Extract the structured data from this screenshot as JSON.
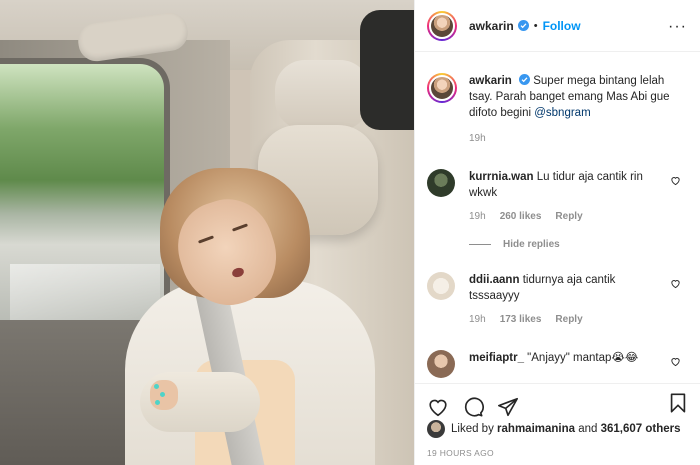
{
  "post": {
    "username": "awkarin",
    "follow_label": "Follow",
    "separator": "•",
    "more_label": "···"
  },
  "caption": {
    "username": "awkarin",
    "text": "Super mega bintang lelah tsay. Parah banget emang Mas Abi gue difoto begini",
    "mention": "@sbngram",
    "time": "19h"
  },
  "comments": [
    {
      "username": "kurrnia.wan",
      "text": "Lu tidur aja cantik rin wkwk",
      "time": "19h",
      "likes": "260 likes",
      "reply_label": "Reply",
      "hide_replies_label": "Hide replies"
    },
    {
      "username": "ddii.aann",
      "text": "tidurnya aja cantik tsssaayyy",
      "time": "19h",
      "likes": "173 likes",
      "reply_label": "Reply"
    },
    {
      "username": "meifiaptr_",
      "text": "\"Anjayy\" mantap😭😂"
    }
  ],
  "likes": {
    "prefix": "Liked by",
    "user": "rahmaimanina",
    "middle": "and",
    "count": "361,607 others"
  },
  "date": "19 HOURS AGO",
  "icons": [
    "verified-badge-icon",
    "heart-icon",
    "comment-icon",
    "share-icon",
    "bookmark-icon",
    "more-icon"
  ],
  "colors": {
    "link": "#0095f6",
    "mention": "#00376b",
    "muted": "#8e8e8e",
    "text": "#262626"
  }
}
